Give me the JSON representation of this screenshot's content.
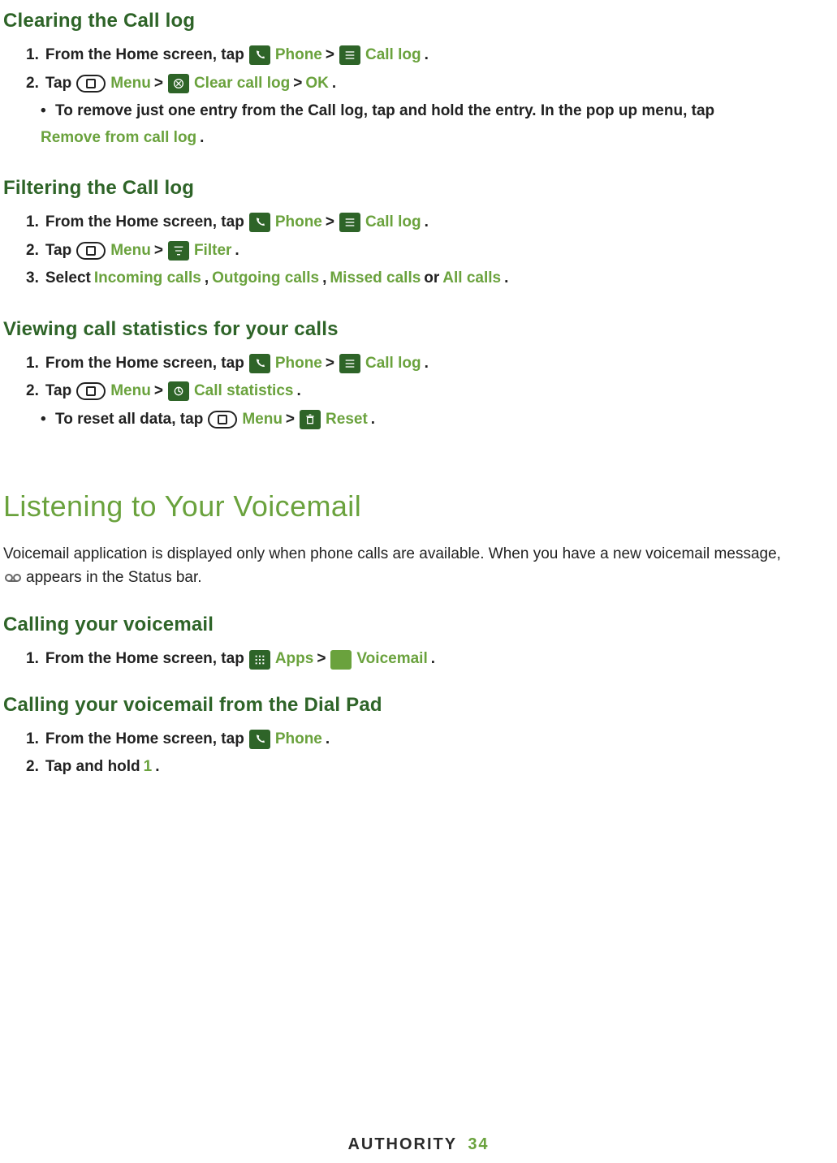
{
  "sections": {
    "clearing": {
      "title": "Clearing the Call log",
      "step1": {
        "num": "1.",
        "pre": "From the Home screen, tap",
        "phone": "Phone",
        "gt1": ">",
        "calllog": "Call log",
        "post": "."
      },
      "step2": {
        "num": "2.",
        "pre": "Tap",
        "menu": "Menu",
        "gt1": ">",
        "clear": "Clear call log",
        "gt2": ">",
        "ok": "OK",
        "post": "."
      },
      "bullet": {
        "dot": "•",
        "pre": "To remove just one entry from the Call log, tap and hold the entry. In the pop up menu, tap",
        "remove": "Remove from call log",
        "post": "."
      }
    },
    "filtering": {
      "title": "Filtering the Call log",
      "step1": {
        "num": "1.",
        "pre": "From the Home screen, tap",
        "phone": "Phone",
        "gt1": ">",
        "calllog": "Call log",
        "post": "."
      },
      "step2": {
        "num": "2.",
        "pre": "Tap",
        "menu": "Menu",
        "gt1": ">",
        "filter": "Filter",
        "post": "."
      },
      "step3": {
        "num": "3.",
        "pre": "Select",
        "in": "Incoming calls",
        "c1": ",",
        "out": "Outgoing calls",
        "c2": ",",
        "miss": "Missed calls",
        "or": "or",
        "all": "All calls",
        "post": "."
      }
    },
    "statistics": {
      "title": "Viewing call statistics for your calls",
      "step1": {
        "num": "1.",
        "pre": "From the Home screen, tap",
        "phone": "Phone",
        "gt1": ">",
        "calllog": "Call log",
        "post": "."
      },
      "step2": {
        "num": "2.",
        "pre": "Tap",
        "menu": "Menu",
        "gt1": ">",
        "stats": "Call statistics",
        "post": "."
      },
      "bullet": {
        "dot": "•",
        "pre": "To reset all data, tap",
        "menu": "Menu",
        "gt1": ">",
        "reset": "Reset",
        "post": "."
      }
    },
    "voicemail": {
      "title": "Listening to Your Voicemail",
      "intro_before": "Voicemail application is displayed only when phone calls are available. When you have a new voicemail message,",
      "intro_after": "appears in the Status bar.",
      "calling": {
        "title": "Calling your voicemail",
        "step1": {
          "num": "1.",
          "pre": "From the Home screen, tap",
          "apps": "Apps",
          "gt": ">",
          "vm": "Voicemail",
          "post": "."
        }
      },
      "dialpad": {
        "title": "Calling your voicemail from the Dial Pad",
        "step1": {
          "num": "1.",
          "pre": "From the Home screen, tap",
          "phone": "Phone",
          "post": "."
        },
        "step2": {
          "num": "2.",
          "pre": "Tap and hold",
          "one": "1",
          "post": "."
        }
      }
    }
  },
  "footer": {
    "brand": "AUTHORITY",
    "page": "34"
  }
}
